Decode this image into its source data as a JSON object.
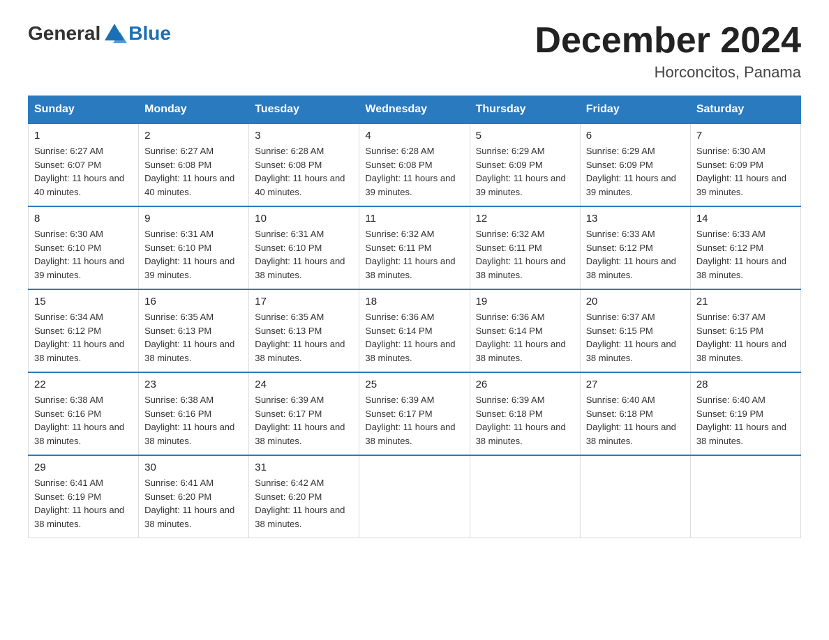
{
  "logo": {
    "text_general": "General",
    "text_blue": "Blue"
  },
  "header": {
    "month": "December 2024",
    "location": "Horconcitos, Panama"
  },
  "weekdays": [
    "Sunday",
    "Monday",
    "Tuesday",
    "Wednesday",
    "Thursday",
    "Friday",
    "Saturday"
  ],
  "weeks": [
    [
      {
        "day": "1",
        "sunrise": "6:27 AM",
        "sunset": "6:07 PM",
        "daylight": "11 hours and 40 minutes."
      },
      {
        "day": "2",
        "sunrise": "6:27 AM",
        "sunset": "6:08 PM",
        "daylight": "11 hours and 40 minutes."
      },
      {
        "day": "3",
        "sunrise": "6:28 AM",
        "sunset": "6:08 PM",
        "daylight": "11 hours and 40 minutes."
      },
      {
        "day": "4",
        "sunrise": "6:28 AM",
        "sunset": "6:08 PM",
        "daylight": "11 hours and 39 minutes."
      },
      {
        "day": "5",
        "sunrise": "6:29 AM",
        "sunset": "6:09 PM",
        "daylight": "11 hours and 39 minutes."
      },
      {
        "day": "6",
        "sunrise": "6:29 AM",
        "sunset": "6:09 PM",
        "daylight": "11 hours and 39 minutes."
      },
      {
        "day": "7",
        "sunrise": "6:30 AM",
        "sunset": "6:09 PM",
        "daylight": "11 hours and 39 minutes."
      }
    ],
    [
      {
        "day": "8",
        "sunrise": "6:30 AM",
        "sunset": "6:10 PM",
        "daylight": "11 hours and 39 minutes."
      },
      {
        "day": "9",
        "sunrise": "6:31 AM",
        "sunset": "6:10 PM",
        "daylight": "11 hours and 39 minutes."
      },
      {
        "day": "10",
        "sunrise": "6:31 AM",
        "sunset": "6:10 PM",
        "daylight": "11 hours and 38 minutes."
      },
      {
        "day": "11",
        "sunrise": "6:32 AM",
        "sunset": "6:11 PM",
        "daylight": "11 hours and 38 minutes."
      },
      {
        "day": "12",
        "sunrise": "6:32 AM",
        "sunset": "6:11 PM",
        "daylight": "11 hours and 38 minutes."
      },
      {
        "day": "13",
        "sunrise": "6:33 AM",
        "sunset": "6:12 PM",
        "daylight": "11 hours and 38 minutes."
      },
      {
        "day": "14",
        "sunrise": "6:33 AM",
        "sunset": "6:12 PM",
        "daylight": "11 hours and 38 minutes."
      }
    ],
    [
      {
        "day": "15",
        "sunrise": "6:34 AM",
        "sunset": "6:12 PM",
        "daylight": "11 hours and 38 minutes."
      },
      {
        "day": "16",
        "sunrise": "6:35 AM",
        "sunset": "6:13 PM",
        "daylight": "11 hours and 38 minutes."
      },
      {
        "day": "17",
        "sunrise": "6:35 AM",
        "sunset": "6:13 PM",
        "daylight": "11 hours and 38 minutes."
      },
      {
        "day": "18",
        "sunrise": "6:36 AM",
        "sunset": "6:14 PM",
        "daylight": "11 hours and 38 minutes."
      },
      {
        "day": "19",
        "sunrise": "6:36 AM",
        "sunset": "6:14 PM",
        "daylight": "11 hours and 38 minutes."
      },
      {
        "day": "20",
        "sunrise": "6:37 AM",
        "sunset": "6:15 PM",
        "daylight": "11 hours and 38 minutes."
      },
      {
        "day": "21",
        "sunrise": "6:37 AM",
        "sunset": "6:15 PM",
        "daylight": "11 hours and 38 minutes."
      }
    ],
    [
      {
        "day": "22",
        "sunrise": "6:38 AM",
        "sunset": "6:16 PM",
        "daylight": "11 hours and 38 minutes."
      },
      {
        "day": "23",
        "sunrise": "6:38 AM",
        "sunset": "6:16 PM",
        "daylight": "11 hours and 38 minutes."
      },
      {
        "day": "24",
        "sunrise": "6:39 AM",
        "sunset": "6:17 PM",
        "daylight": "11 hours and 38 minutes."
      },
      {
        "day": "25",
        "sunrise": "6:39 AM",
        "sunset": "6:17 PM",
        "daylight": "11 hours and 38 minutes."
      },
      {
        "day": "26",
        "sunrise": "6:39 AM",
        "sunset": "6:18 PM",
        "daylight": "11 hours and 38 minutes."
      },
      {
        "day": "27",
        "sunrise": "6:40 AM",
        "sunset": "6:18 PM",
        "daylight": "11 hours and 38 minutes."
      },
      {
        "day": "28",
        "sunrise": "6:40 AM",
        "sunset": "6:19 PM",
        "daylight": "11 hours and 38 minutes."
      }
    ],
    [
      {
        "day": "29",
        "sunrise": "6:41 AM",
        "sunset": "6:19 PM",
        "daylight": "11 hours and 38 minutes."
      },
      {
        "day": "30",
        "sunrise": "6:41 AM",
        "sunset": "6:20 PM",
        "daylight": "11 hours and 38 minutes."
      },
      {
        "day": "31",
        "sunrise": "6:42 AM",
        "sunset": "6:20 PM",
        "daylight": "11 hours and 38 minutes."
      },
      null,
      null,
      null,
      null
    ]
  ]
}
